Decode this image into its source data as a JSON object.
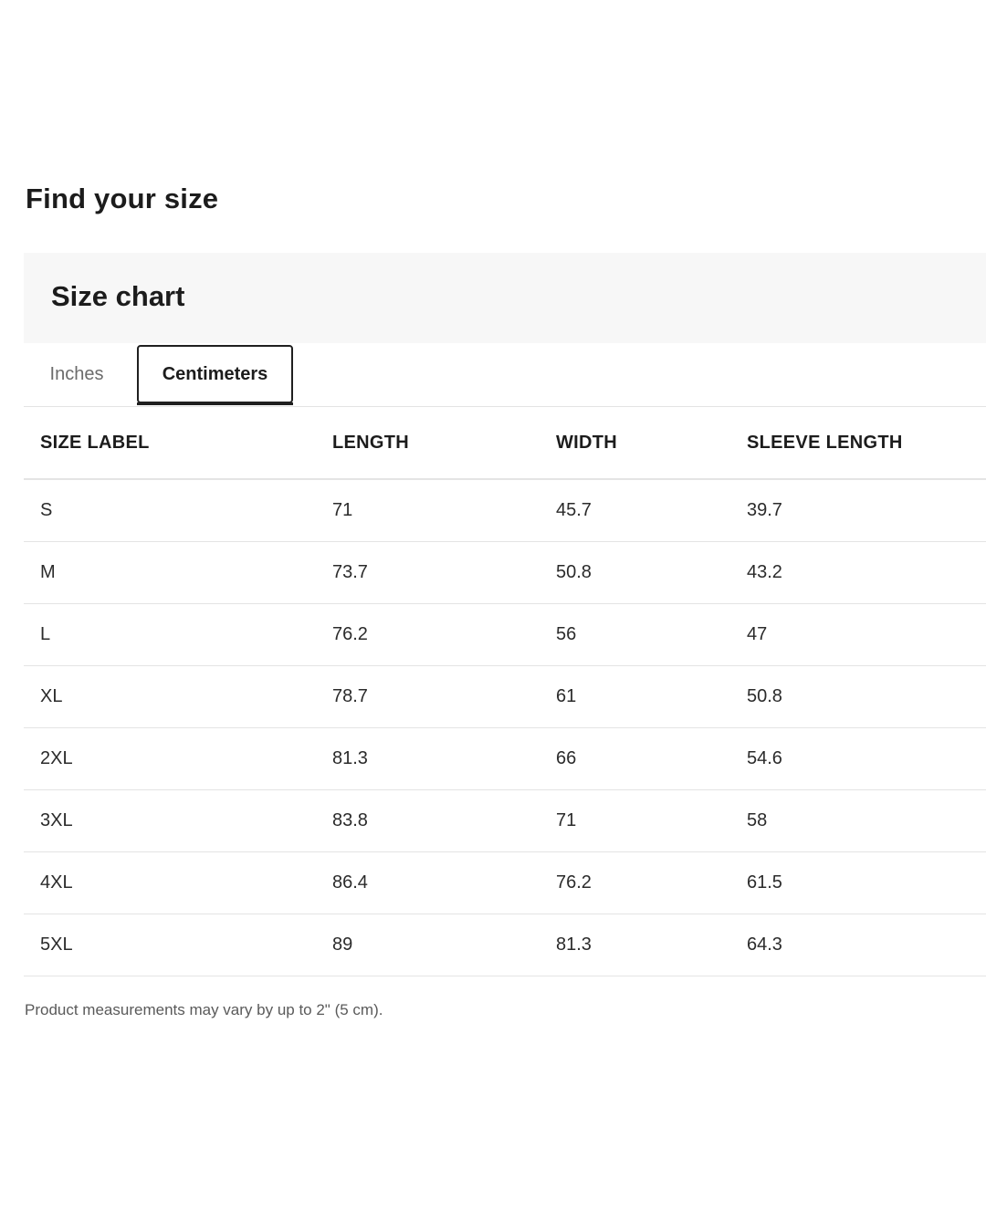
{
  "page": {
    "title": "Find your size"
  },
  "chart": {
    "title": "Size chart",
    "tabs": [
      {
        "label": "Inches",
        "selected": false
      },
      {
        "label": "Centimeters",
        "selected": true
      }
    ]
  },
  "table": {
    "headers": [
      "SIZE LABEL",
      "LENGTH",
      "WIDTH",
      "SLEEVE LENGTH"
    ],
    "rows": [
      [
        "S",
        "71",
        "45.7",
        "39.7"
      ],
      [
        "M",
        "73.7",
        "50.8",
        "43.2"
      ],
      [
        "L",
        "76.2",
        "56",
        "47"
      ],
      [
        "XL",
        "78.7",
        "61",
        "50.8"
      ],
      [
        "2XL",
        "81.3",
        "66",
        "54.6"
      ],
      [
        "3XL",
        "83.8",
        "71",
        "58"
      ],
      [
        "4XL",
        "86.4",
        "76.2",
        "61.5"
      ],
      [
        "5XL",
        "89",
        "81.3",
        "64.3"
      ]
    ]
  },
  "note": "Product measurements may vary by up to 2\" (5 cm).",
  "colors": {
    "header_bg": "#f7f7f7",
    "text": "#1c1c1c",
    "divider": "#e4e4e4"
  }
}
